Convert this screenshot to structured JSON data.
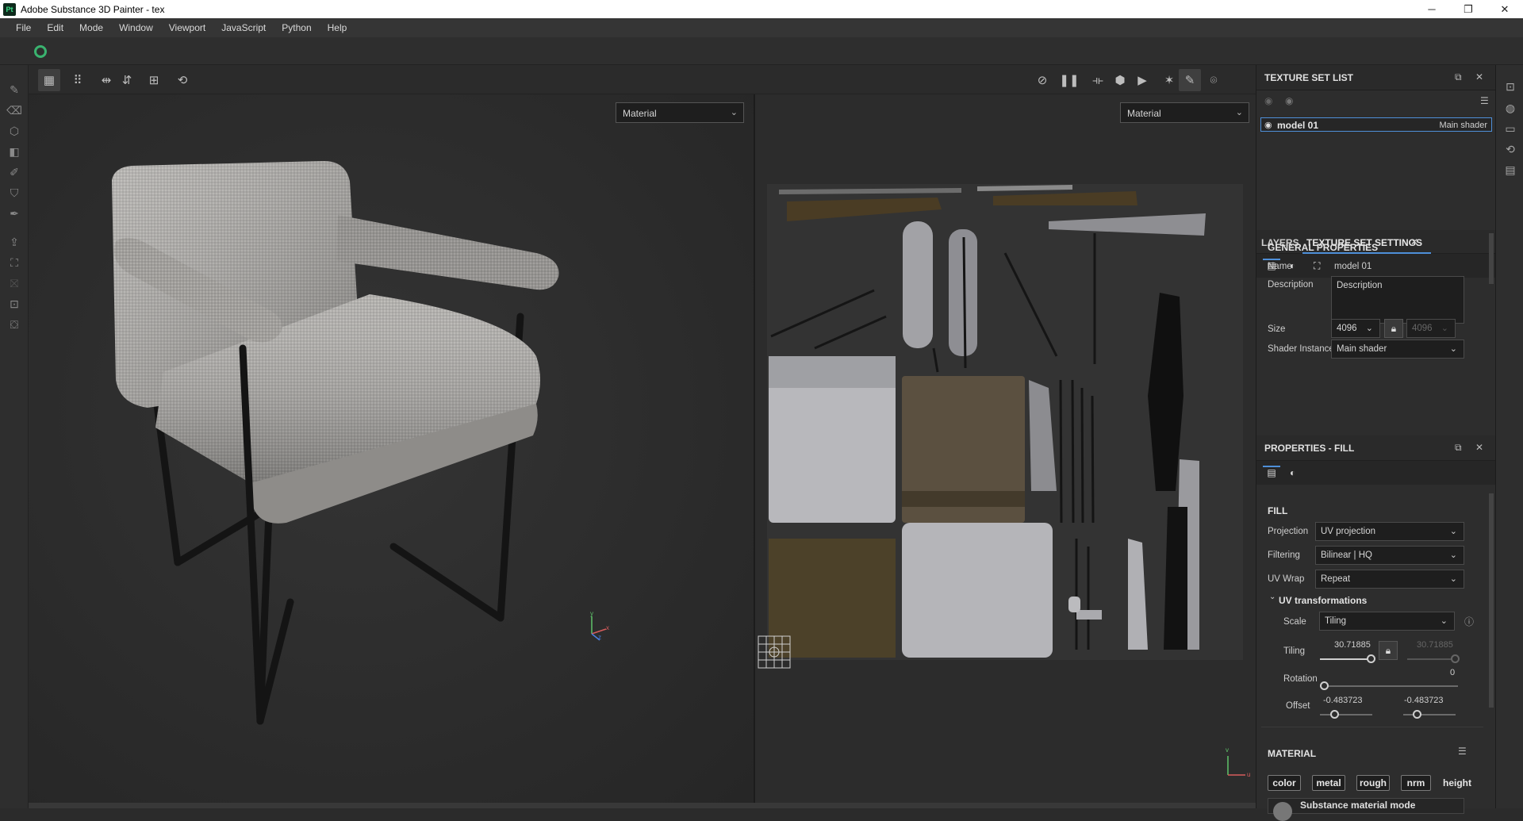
{
  "window": {
    "title": "Adobe Substance 3D Painter - tex",
    "app_icon": "Pt"
  },
  "menu": [
    "File",
    "Edit",
    "Mode",
    "Window",
    "Viewport",
    "JavaScript",
    "Python",
    "Help"
  ],
  "viewport": {
    "left_mode": "Material",
    "right_mode": "Material",
    "axis_3d": {
      "x": "x",
      "y": "y",
      "z": "z"
    },
    "axis_2d": {
      "v": "v",
      "u": "u"
    }
  },
  "texture_set_list": {
    "title": "TEXTURE SET LIST",
    "item_name": "model 01",
    "item_shader": "Main shader"
  },
  "tabs": {
    "layers": "LAYERS",
    "settings": "TEXTURE SET SETTINGS"
  },
  "general": {
    "section": "GENERAL PROPERTIES",
    "name_label": "Name",
    "name_value": "model 01",
    "desc_label": "Description",
    "desc_value": "Description",
    "size_label": "Size",
    "size_value": "4096",
    "size_value2": "4096",
    "shader_label": "Shader Instance",
    "shader_value": "Main shader"
  },
  "properties": {
    "title": "PROPERTIES - FILL",
    "section": "FILL",
    "projection_label": "Projection",
    "projection_value": "UV projection",
    "filtering_label": "Filtering",
    "filtering_value": "Bilinear | HQ",
    "uvwrap_label": "UV Wrap",
    "uvwrap_value": "Repeat",
    "uvt_label": "UV transformations",
    "scale_label": "Scale",
    "scale_value": "Tiling",
    "tiling_label": "Tiling",
    "tiling_u": "30.71885",
    "tiling_v": "30.71885",
    "rotation_label": "Rotation",
    "rotation_value": "0",
    "offset_label": "Offset",
    "offset_u": "-0.483723",
    "offset_v": "-0.483723"
  },
  "material": {
    "section": "MATERIAL",
    "channels": [
      "color",
      "metal",
      "rough",
      "nrm",
      "height"
    ],
    "mode_label": "Substance material mode"
  }
}
